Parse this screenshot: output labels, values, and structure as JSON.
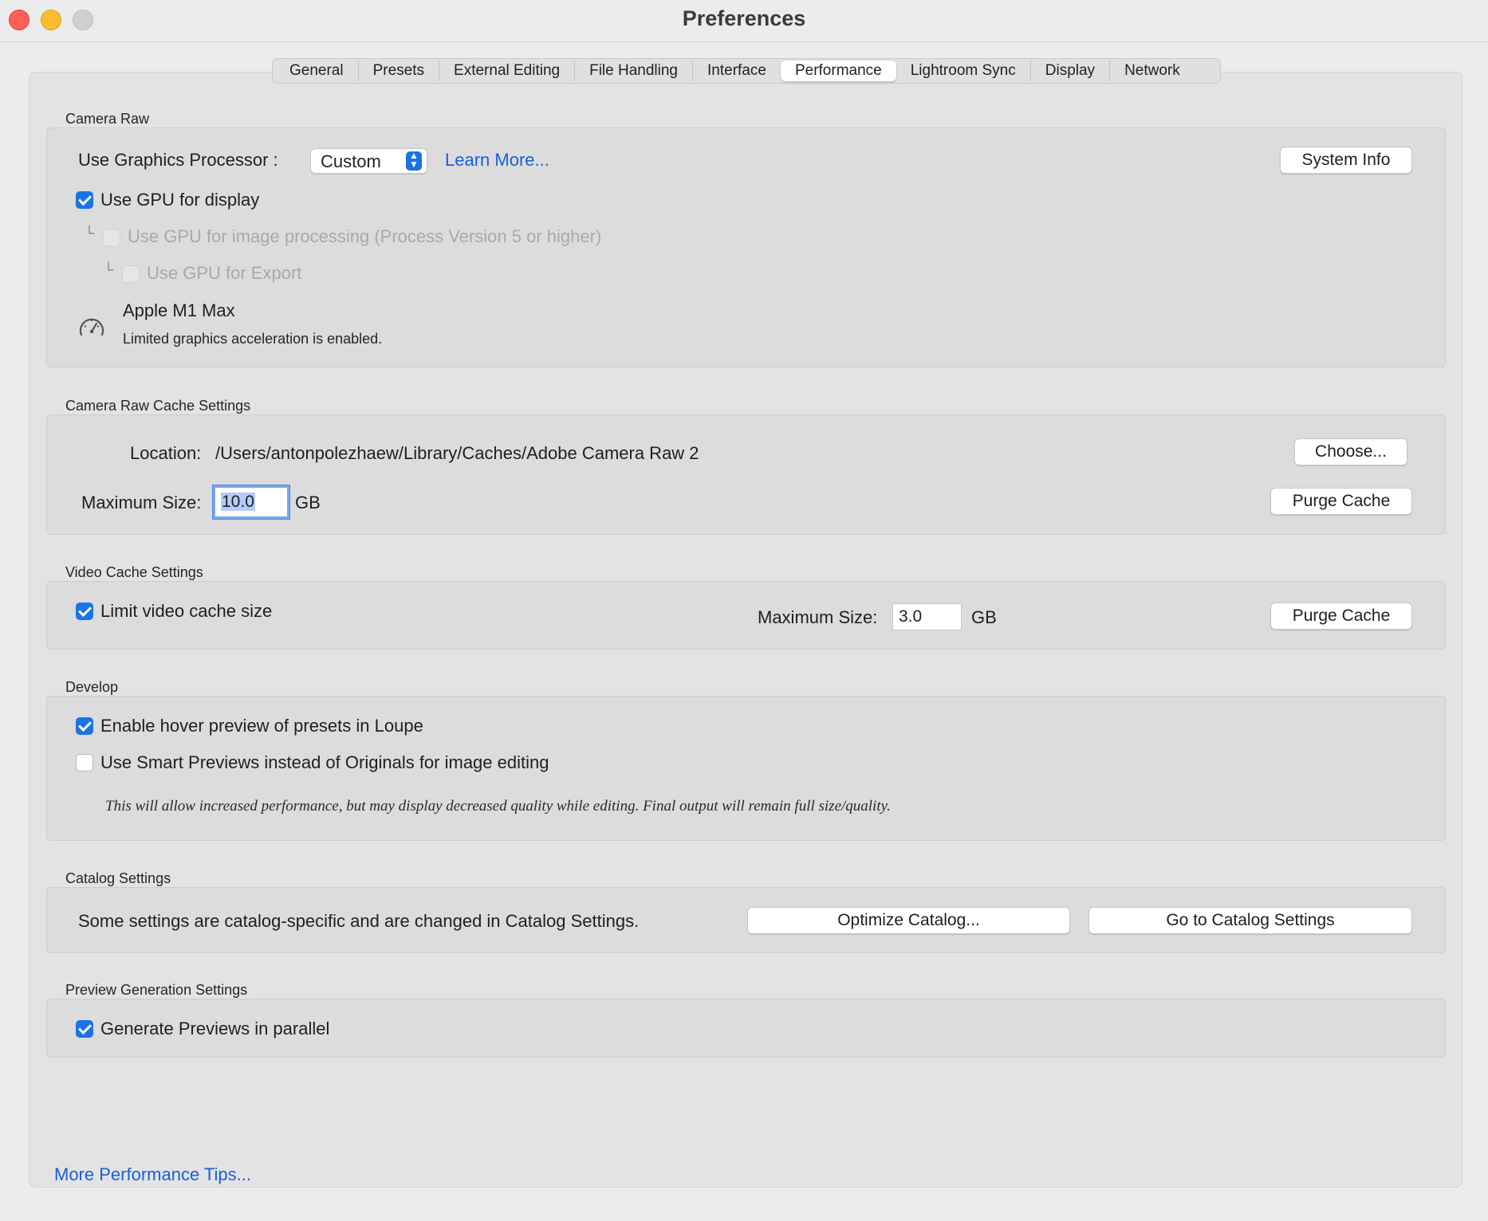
{
  "window": {
    "title": "Preferences"
  },
  "tabs": [
    {
      "label": "General"
    },
    {
      "label": "Presets"
    },
    {
      "label": "External Editing"
    },
    {
      "label": "File Handling"
    },
    {
      "label": "Interface"
    },
    {
      "label": "Performance",
      "active": true
    },
    {
      "label": "Lightroom Sync"
    },
    {
      "label": "Display"
    },
    {
      "label": "Network"
    }
  ],
  "camera_raw": {
    "section_label": "Camera Raw",
    "gpu_label": "Use Graphics Processor :",
    "gpu_select_value": "Custom",
    "learn_more": "Learn More...",
    "system_info_button": "System Info",
    "use_gpu_display": {
      "label": "Use GPU for display",
      "checked": true
    },
    "use_gpu_processing": {
      "label": "Use GPU for image processing (Process Version 5 or higher)",
      "checked": false,
      "disabled": true
    },
    "use_gpu_export": {
      "label": "Use GPU for Export",
      "checked": false,
      "disabled": true
    },
    "gpu_name": "Apple M1 Max",
    "gpu_status": "Limited graphics acceleration is enabled.",
    "gpu_icon": "speedometer-icon"
  },
  "camera_raw_cache": {
    "section_label": "Camera Raw Cache Settings",
    "location_label": "Location:",
    "location_value": "/Users/antonpolezhaew/Library/Caches/Adobe Camera Raw 2",
    "choose_button": "Choose...",
    "max_size_label": "Maximum Size:",
    "max_size_value": "10.0",
    "max_size_unit": "GB",
    "purge_button": "Purge Cache"
  },
  "video_cache": {
    "section_label": "Video Cache Settings",
    "limit_checkbox": {
      "label": "Limit video cache size",
      "checked": true
    },
    "max_size_label": "Maximum Size:",
    "max_size_value": "3.0",
    "max_size_unit": "GB",
    "purge_button": "Purge Cache"
  },
  "develop": {
    "section_label": "Develop",
    "hover_preview": {
      "label": "Enable hover preview of presets in Loupe",
      "checked": true
    },
    "smart_previews": {
      "label": "Use Smart Previews instead of Originals for image editing",
      "checked": false
    },
    "note": "This will allow increased performance, but may display decreased quality while editing. Final output will remain full size/quality."
  },
  "catalog": {
    "section_label": "Catalog Settings",
    "description": "Some settings are catalog-specific and are changed in Catalog Settings.",
    "optimize_button": "Optimize Catalog...",
    "goto_button": "Go to Catalog Settings"
  },
  "preview_generation": {
    "section_label": "Preview Generation Settings",
    "parallel": {
      "label": "Generate Previews in parallel",
      "checked": true
    }
  },
  "footer": {
    "tips_link": "More Performance Tips..."
  },
  "colors": {
    "accent": "#1a73e8",
    "link": "#1a5fd6",
    "close": "#fe5f57",
    "minimize": "#febc2e"
  }
}
